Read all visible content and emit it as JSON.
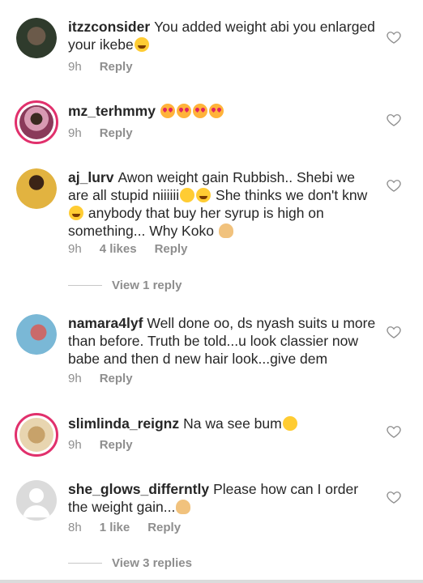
{
  "comments": [
    {
      "username": "itzzconsider",
      "text": "You added weight abi you enlarged your ikebe",
      "emoji_after": [
        "laugh"
      ],
      "time": "9h",
      "likes": "",
      "reply_label": "Reply",
      "avatar_colors": [
        "#6b5a4a",
        "#2f3b2c"
      ]
    },
    {
      "username": "mz_terhmmy",
      "text": "",
      "emoji_after": [
        "love",
        "love",
        "love",
        "love"
      ],
      "time": "9h",
      "likes": "",
      "reply_label": "Reply",
      "avatar_colors": [
        "#8a3a5a",
        "#d89ab2"
      ]
    },
    {
      "username": "aj_lurv",
      "text": "Awon weight gain Rubbish.. Shebi we are all stupid niiiiii",
      "text_2": "She thinks we don't knw",
      "text_3": "anybody that buy her syrup is high on something... Why Koko",
      "time": "9h",
      "likes": "4 likes",
      "reply_label": "Reply",
      "avatar_colors": [
        "#e2b340",
        "#7a4a2a"
      ]
    },
    {
      "username": "namara4lyf",
      "text": "Well done oo, ds nyash suits u more than before. Truth be told...u look classier now babe and then d new hair look...give dem",
      "time": "9h",
      "likes": "",
      "reply_label": "Reply",
      "avatar_colors": [
        "#c96a6a",
        "#7ab8d6"
      ]
    },
    {
      "username": "slimlinda_reignz",
      "text": "Na wa see bum",
      "emoji_after": [
        "wink"
      ],
      "time": "9h",
      "likes": "",
      "reply_label": "Reply",
      "avatar_colors": [
        "#c7a26a",
        "#e8d5b0"
      ]
    },
    {
      "username": "she_glows_differntly",
      "text": "Please how can I order the weight gain...",
      "emoji_after": [
        "person"
      ],
      "time": "8h",
      "likes": "1 like",
      "reply_label": "Reply",
      "avatar_colors": [
        "#dbdbdb",
        "#ffffff"
      ]
    }
  ],
  "view_reply_1": "View 1 reply",
  "view_reply_3": "View 3 replies",
  "colors": {
    "text": "#262626",
    "meta": "#8e8e8e",
    "story_ring": "#e1306c",
    "separator": "#c7c7c7"
  }
}
